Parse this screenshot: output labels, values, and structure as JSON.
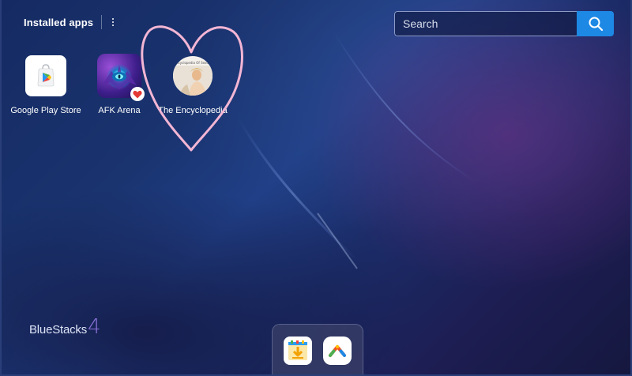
{
  "header": {
    "title": "Installed apps"
  },
  "search": {
    "placeholder": "Search",
    "icon": "search-icon"
  },
  "apps": [
    {
      "label": "Google Play Store",
      "icon": "google-play-store-icon"
    },
    {
      "label": "AFK Arena",
      "icon": "afk-arena-icon",
      "badge": "heart-icon"
    },
    {
      "label": "The Encyclopedia",
      "icon": "encyclopedia-app-icon",
      "cover_text": "Encyclopedia Of Sexual"
    }
  ],
  "branding": {
    "name": "BlueStacks",
    "version": "4"
  },
  "dock": {
    "items": [
      {
        "icon": "apk-installer-icon"
      },
      {
        "icon": "game-center-icon"
      }
    ]
  },
  "colors": {
    "accent": "#1e88e5",
    "heart": "#e53935",
    "annotation": "#f3b6d4"
  }
}
